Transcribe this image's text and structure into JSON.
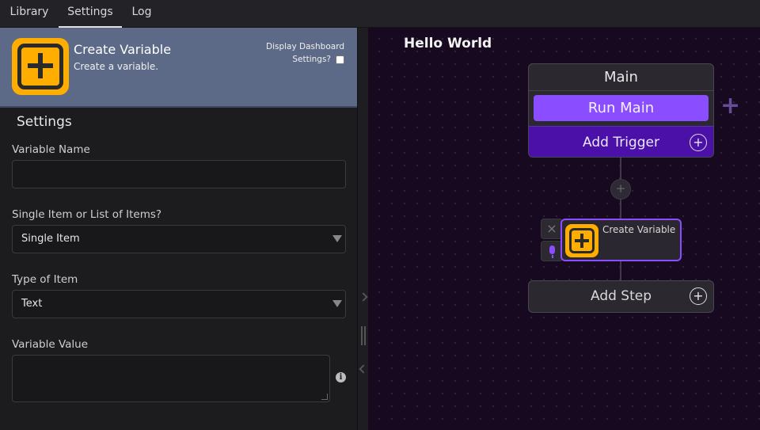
{
  "tabs": [
    {
      "label": "Library",
      "active": false
    },
    {
      "label": "Settings",
      "active": true
    },
    {
      "label": "Log",
      "active": false
    }
  ],
  "header": {
    "title": "Create Variable",
    "description": "Create a variable.",
    "dashboard_label_1": "Display Dashboard",
    "dashboard_label_2": "Settings?",
    "icon": "plus-square-icon",
    "icon_color": "#ffae00",
    "bg_color": "#5d6a87"
  },
  "settings": {
    "title": "Settings",
    "variable_name": {
      "label": "Variable Name",
      "value": ""
    },
    "list_type": {
      "label": "Single Item or List of Items?",
      "value": "Single Item"
    },
    "item_type": {
      "label": "Type of Item",
      "value": "Text"
    },
    "variable_value": {
      "label": "Variable Value",
      "value": ""
    }
  },
  "canvas": {
    "title": "Hello World",
    "main_card": {
      "title": "Main",
      "run_label": "Run Main",
      "trigger_label": "Add Trigger",
      "accent": "#8a4dff"
    },
    "step": {
      "label": "Create Variable"
    },
    "add_step_label": "Add Step"
  }
}
